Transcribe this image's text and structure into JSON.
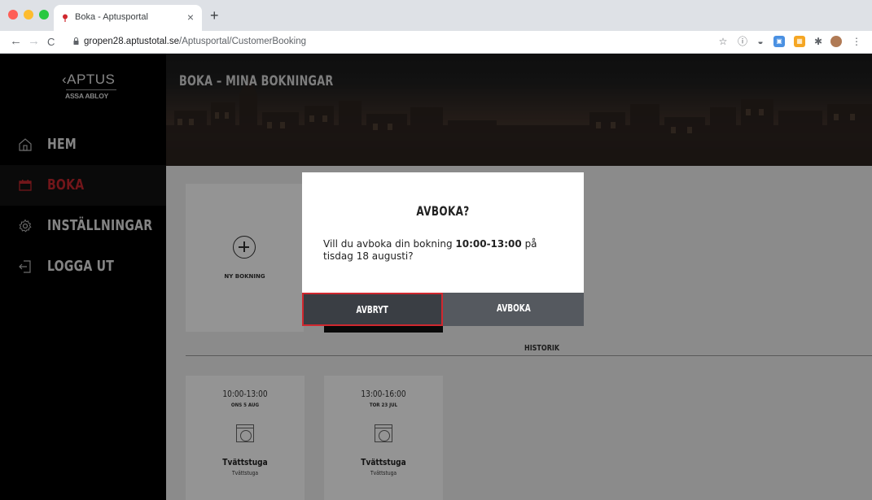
{
  "browser": {
    "tab_title": "Boka - Aptusportal",
    "tab_close": "×",
    "new_tab": "+",
    "back": "←",
    "forward": "→",
    "reload": "C",
    "url_host": "gropen28.aptustotal.se",
    "url_path": "/Aptusportal/CustomerBooking",
    "icons": [
      "star-icon",
      "info-icon",
      "circle-extension-icon",
      "blue-extension-icon",
      "orange-extension-icon",
      "puzzle-icon",
      "profile-avatar",
      "kebab-menu-icon"
    ]
  },
  "brand": {
    "logo_top": "‹APTUS",
    "logo_bottom": "ASSA ABLOY"
  },
  "sidebar": {
    "items": [
      {
        "label": "HEM",
        "icon": "home-icon",
        "active": false
      },
      {
        "label": "BOKA",
        "icon": "calendar-icon",
        "active": true
      },
      {
        "label": "INSTÄLLNINGAR",
        "icon": "gear-icon",
        "active": false
      },
      {
        "label": "LOGGA UT",
        "icon": "logout-icon",
        "active": false
      }
    ]
  },
  "header": {
    "title": "BOKA – MINA BOKNINGAR"
  },
  "main": {
    "new_booking_label": "NY BOKNING",
    "history_label": "HISTORIK",
    "history": [
      {
        "time": "10:00-13:00",
        "date": "ONS 5 AUG",
        "name": "Tvättstuga",
        "sub": "Tvättstuga"
      },
      {
        "time": "13:00-16:00",
        "date": "TOR 23 JUL",
        "name": "Tvättstuga",
        "sub": "Tvättstuga"
      }
    ]
  },
  "dialog": {
    "title": "AVBOKA?",
    "body_prefix": "Vill du avboka din bokning ",
    "body_time": "10:00-13:00",
    "body_suffix": " på tisdag 18 augusti?",
    "cancel_label": "AVBRYT",
    "confirm_label": "AVBOKA"
  },
  "colors": {
    "accent_red": "#c4262e",
    "sidebar_bg": "#000000",
    "dialog_button_dark": "#3a3e44"
  }
}
